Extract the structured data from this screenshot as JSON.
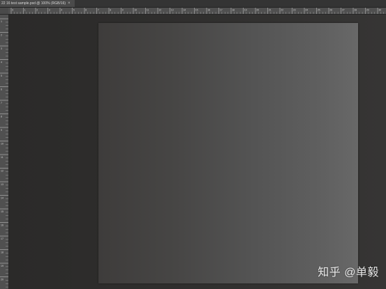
{
  "window": {
    "doc_tab_label": "22 16 test sample.psd @ 100% (RGB/16)",
    "close_glyph": "×"
  },
  "rulers": {
    "top_labels": [
      "0",
      "1",
      "2",
      "3",
      "4",
      "5",
      "6",
      "7",
      "8",
      "9",
      "10",
      "11",
      "12",
      "13",
      "14",
      "15",
      "16",
      "17",
      "18",
      "19",
      "20",
      "21",
      "22",
      "23",
      "24",
      "25",
      "26",
      "27",
      "28",
      "29",
      "30"
    ],
    "left_labels": [
      "1",
      "2",
      "3",
      "4",
      "5",
      "6",
      "7",
      "8",
      "9",
      "10",
      "11",
      "12",
      "13",
      "14",
      "15",
      "16",
      "17",
      "18",
      "19",
      "20"
    ]
  },
  "watermark": {
    "text": "知乎 @单毅"
  },
  "colors": {
    "workspace": "#2d2d2d",
    "ruler": "#505050",
    "document_left": "#3e3c3b",
    "document_right": "#686868"
  }
}
